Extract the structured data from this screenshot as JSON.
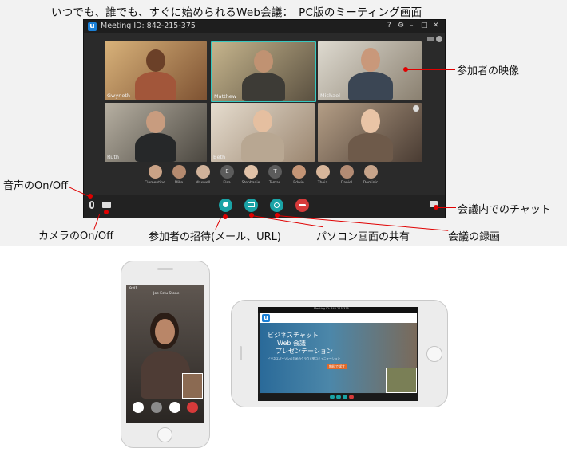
{
  "headline": "いつでも、誰でも、すぐに始められるWeb会議：　PC版のミーティング画面",
  "meeting": {
    "logo": "u",
    "id_label": "Meeting ID: 842-215-375",
    "window_controls": [
      "?",
      "⚙",
      "–",
      "□",
      "✕"
    ],
    "tiles": [
      {
        "name": "Gwyneth"
      },
      {
        "name": "Matthew"
      },
      {
        "name": "Michael"
      },
      {
        "name": "Ruth"
      },
      {
        "name": "Beth"
      },
      {
        "name": ""
      }
    ],
    "roster": [
      "Clementine",
      "Mike",
      "Maxwell",
      "Elsa",
      "Stephanie",
      "Tomas",
      "Edwin",
      "Theia",
      "Daniel",
      "Dominic"
    ],
    "roster_initials": {
      "3": "E",
      "5": "T"
    },
    "buttons": {
      "mic": "microphone-icon",
      "camera": "camera-icon",
      "invite": "invite-icon",
      "share": "screen-share-icon",
      "record": "record-icon",
      "hangup": "hangup-icon",
      "chat": "chat-icon"
    }
  },
  "annotations": {
    "video": "参加者の映像",
    "audio": "音声のOn/Off",
    "chat": "会議内でのチャット",
    "camera": "カメラのOn/Off",
    "invite": "参加者の招待(メール、URL)",
    "share": "パソコン画面の共有",
    "record": "会議の録画"
  },
  "phone": {
    "caller_name": "Joe Estu Stone",
    "status_bar": "9:41"
  },
  "landscape": {
    "title": "Meeting ID: 842-215-375",
    "logo": "u",
    "heading": "ビジネスチャット",
    "sub1": "Web 会議",
    "sub2": "プレゼンテーション",
    "blurb": "ビジネスパーソンのためのクラウド型コミュニケーション",
    "cta": "無料で試す"
  },
  "colors": {
    "brand": "#1a7fd6",
    "accent_red": "#e00000",
    "hangup": "#d63a3a",
    "teal": "#1aa3a6"
  }
}
